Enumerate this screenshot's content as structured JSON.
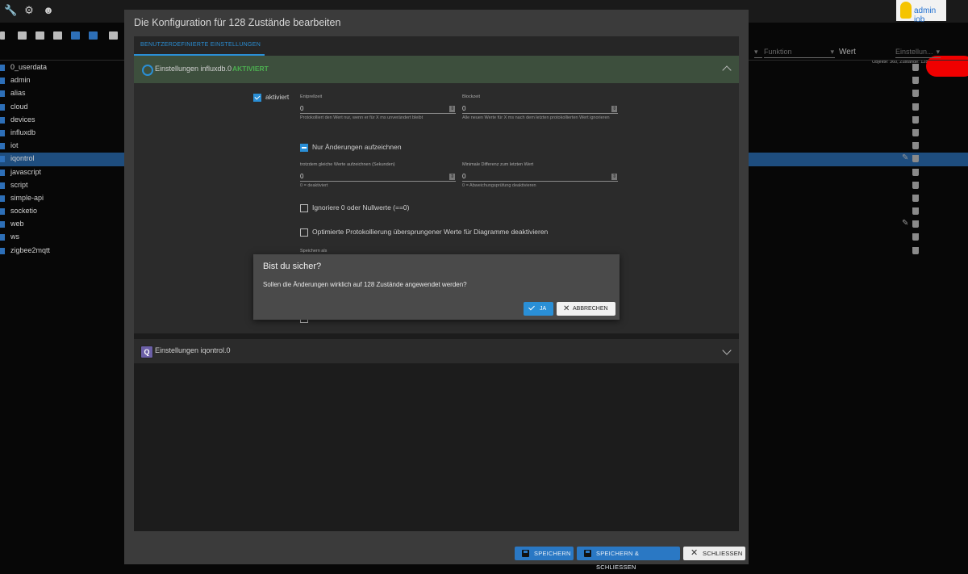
{
  "background": {
    "topbar_icons": [
      "wrench-icon",
      "gear-icon",
      "user-head-icon"
    ],
    "user": {
      "name": "admin iob"
    },
    "objects_info": "Objekte: 360, Zustände: 128",
    "columns": {
      "function": "Funktion",
      "value": "Wert",
      "settings": "Einstellun..."
    },
    "tree": [
      {
        "label": "0_userdata"
      },
      {
        "label": "admin"
      },
      {
        "label": "alias"
      },
      {
        "label": "cloud"
      },
      {
        "label": "devices"
      },
      {
        "label": "influxdb"
      },
      {
        "label": "iot"
      },
      {
        "label": "iqontrol",
        "highlight": true
      },
      {
        "label": "javascript"
      },
      {
        "label": "script"
      },
      {
        "label": "simple-api"
      },
      {
        "label": "socketio"
      },
      {
        "label": "web"
      },
      {
        "label": "ws"
      },
      {
        "label": "zigbee2mqtt"
      }
    ]
  },
  "modal": {
    "title": "Die Konfiguration für 128 Zustände bearbeiten",
    "tab": "BENUTZERDEFINIERTE EINSTELLUNGEN",
    "section1": {
      "title": "Einstellungen influxdb.0",
      "badge": "AKTIVIERT"
    },
    "form": {
      "aktiviert": {
        "label": "aktiviert",
        "checked": true
      },
      "entprellzeit": {
        "label": "Entprellzeit",
        "value": "0",
        "helper": "Protokolliert den Wert nur, wenn er für X ms unverändert bleibt"
      },
      "blockzeit": {
        "label": "Blockzeit",
        "value": "0",
        "helper": "Alle neuen Werte für X ms nach dem letzten protokollierten Wert ignorieren"
      },
      "nur_aenderungen": {
        "label": "Nur Änderungen aufzeichnen",
        "state": "indeterminate"
      },
      "trotzdem": {
        "label": "trotzdem gleiche Werte aufzeichnen (Sekunden)",
        "value": "0",
        "helper": "0 = deaktiviert"
      },
      "min_diff": {
        "label": "Minimale Differenz zum letzten Wert",
        "value": "0",
        "helper": "0 = Abweichungsprüfung deaktivieren"
      },
      "ignoriere": {
        "label": "Ignoriere 0 oder Nullwerte (==0)",
        "checked": false
      },
      "optimiert": {
        "label": "Optimierte Protokollierung übersprungener Werte für Diagramme deaktivieren",
        "checked": false
      },
      "speichern_als": {
        "label": "Speichern als"
      }
    },
    "section2": {
      "title": "Einstellungen iqontrol.0"
    },
    "buttons": {
      "save": "SPEICHERN",
      "save_close": "SPEICHERN & SCHLIESSEN",
      "close": "SCHLIESSEN"
    }
  },
  "confirm": {
    "title": "Bist du sicher?",
    "message": "Sollen die Änderungen wirklich auf 128 Zustände angewendet werden?",
    "yes": "JA",
    "cancel": "ABBRECHEN"
  }
}
